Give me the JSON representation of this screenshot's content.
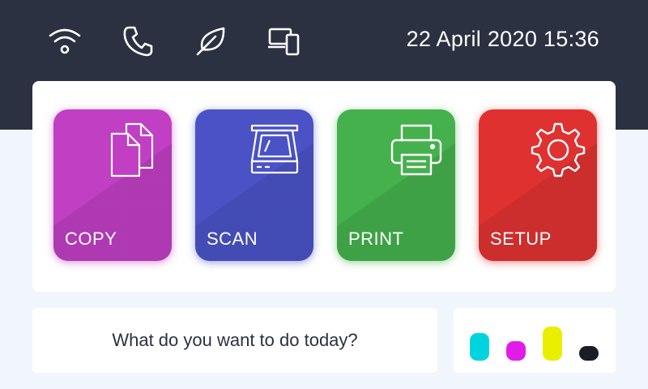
{
  "status_bar": {
    "icons": [
      "wifi-icon",
      "phone-icon",
      "leaf-icon",
      "devices-icon"
    ],
    "datetime": "22 April 2020 15:36"
  },
  "tiles": [
    {
      "label": "COPY",
      "icon": "copy-icon",
      "color": "#c03fc3"
    },
    {
      "label": "SCAN",
      "icon": "scanner-icon",
      "color": "#4a52c6"
    },
    {
      "label": "PRINT",
      "icon": "printer-icon",
      "color": "#45b14d"
    },
    {
      "label": "SETUP",
      "icon": "gear-icon",
      "color": "#e03131"
    }
  ],
  "prompt": "What do you want to do today?",
  "ink_levels": [
    {
      "name": "cyan",
      "color": "#00d5df",
      "level": 0.6
    },
    {
      "name": "magenta",
      "color": "#e21ce8",
      "level": 0.35
    },
    {
      "name": "yellow",
      "color": "#eaef00",
      "level": 0.8
    },
    {
      "name": "black",
      "color": "#1a1d26",
      "level": 0.2
    }
  ]
}
